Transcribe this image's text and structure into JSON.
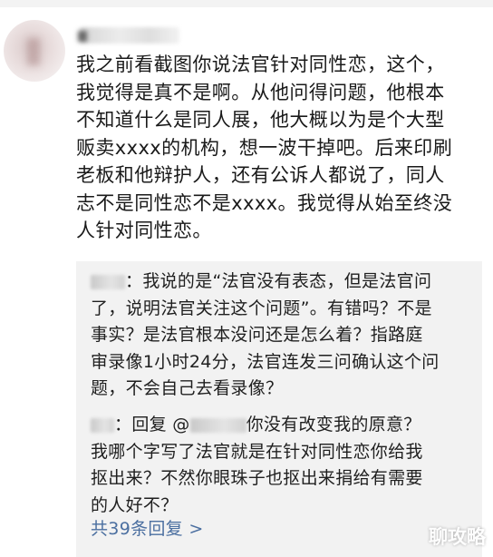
{
  "comment": {
    "text": "我之前看截图你说法官针对同性恋，这个，\n我觉得是真不是啊。从他问得问题，他根本\n不知道什么是同人展，他大概以为是个大型\n贩卖xxxx的机构，想一波干掉吧。后来印刷\n老板和他辩护人，还有公诉人都说了，同人\n志不是同性恋不是xxxx。我觉得从始至终没\n人针对同性恋。"
  },
  "replies": [
    {
      "separator": "：",
      "text": "我说的是“法官没有表态，但是法官问\n了，说明法官关注这个问题”。有错吗？不是\n事实？是法官根本没问还是怎么着？指路庭\n审录像1小时24分，法官连发三问确认这个问\n题，不会自己去看录像？"
    },
    {
      "separator": "：",
      "reply_label": "回复",
      "mention_prefix": "@",
      "text_after_mention": "你没有改变我的原意？",
      "text_rest": "我哪个字写了法官就是在针对同性恋你给我\n抠出来？不然你眼珠子也抠出来捐给有需要\n的人好不？"
    }
  ],
  "more_replies": "共39条回复 >",
  "watermark": "聊攻略"
}
